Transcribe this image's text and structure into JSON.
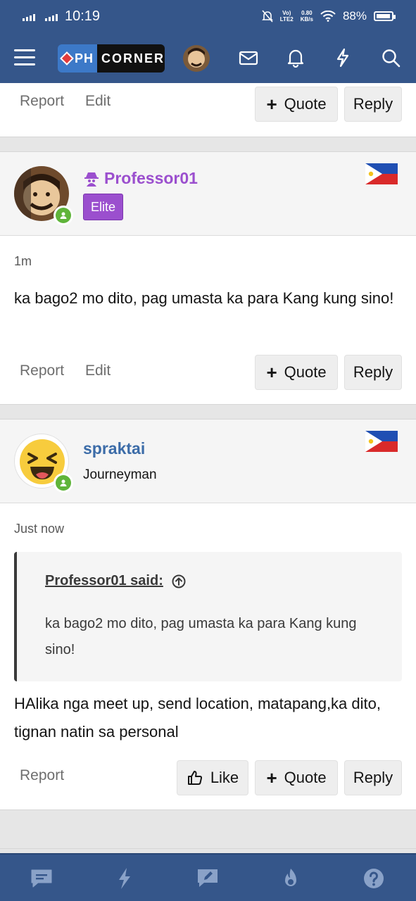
{
  "status_bar": {
    "time": "10:19",
    "net_speed": "0.80",
    "net_unit": "KB/s",
    "lte": "LTE2",
    "volte": "Vo)",
    "battery": "88%"
  },
  "nav": {
    "logo_ph": "PH",
    "logo_corner": "CORNER"
  },
  "post_top": {
    "report": "Report",
    "edit": "Edit",
    "quote": "Quote",
    "reply": "Reply"
  },
  "post1": {
    "username": "Professor01",
    "user_title": "Elite",
    "time": "1m",
    "message": "ka bago2 mo dito, pag umasta ka para Kang kung sino!",
    "report": "Report",
    "edit": "Edit",
    "quote": "Quote",
    "reply": "Reply"
  },
  "post2": {
    "username": "spraktai",
    "user_title": "Journeyman",
    "time": "Just now",
    "quote_author": "Professor01 said:",
    "quote_text": "ka bago2 mo dito, pag umasta ka para Kang kung sino!",
    "message": "HAlika nga meet up, send location, matapang,ka dito, tignan natin sa personal",
    "report": "Report",
    "like": "Like",
    "quote": "Quote",
    "reply": "Reply"
  },
  "colors": {
    "header": "#35568a",
    "elite": "#9b4fce",
    "username_blue": "#3c6ca8",
    "online": "#5fb43a"
  }
}
